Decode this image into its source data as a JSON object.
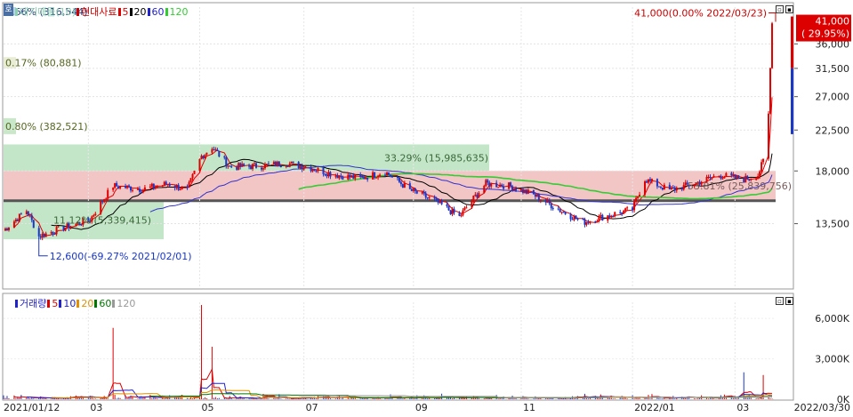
{
  "price_panel": {
    "legend": [
      {
        "text": "대기매물(10)",
        "color": "#8fd0b0"
      },
      {
        "text": "현대사료",
        "color": "#cc0000"
      },
      {
        "text": "5",
        "color": "#e00000"
      },
      {
        "text": "20",
        "color": "#000000"
      },
      {
        "text": "60",
        "color": "#2222cc"
      },
      {
        "text": "120",
        "color": "#33cc33"
      }
    ],
    "corner_badge": "호",
    "current_price": "41,000",
    "current_change": "( 29.95%)",
    "high_annotation": "41,000(0.00% 2022/03/23)",
    "low_annotation": "12,600(-69.27% 2021/02/01)",
    "y_ticks": [
      "36,000",
      "31,500",
      "27,000",
      "22,500",
      "18,000",
      "13,500"
    ],
    "y_tick_values": [
      36000,
      31500,
      27000,
      22500,
      18000,
      13500
    ],
    "y_range": [
      9500,
      44000
    ]
  },
  "volume_profile": [
    {
      "label": "0.66% (316,544)",
      "low": 42000,
      "high": 44000,
      "pct": 0.66,
      "color": "#b9d3ea"
    },
    {
      "label": "0.17% (80,881)",
      "low": 31500,
      "high": 33500,
      "pct": 0.17,
      "color": "#e9edd6"
    },
    {
      "label": "0.80% (382,521)",
      "low": 22000,
      "high": 24000,
      "pct": 0.8,
      "color": "#c9e8c9"
    },
    {
      "label": "33.29% (15,985,635)",
      "low": 18000,
      "high": 20800,
      "pct": 33.29,
      "color": "#c4e6c8"
    },
    {
      "label": "53.81% (25,839,756)",
      "low": 15300,
      "high": 18000,
      "pct": 53.81,
      "color": "#f3c6c6"
    },
    {
      "label": "11.12% (5,339,415)",
      "low": 12400,
      "high": 15300,
      "pct": 11.12,
      "color": "#c4e6c8"
    }
  ],
  "volume_panel": {
    "legend": [
      {
        "text": "거래량",
        "color": "#2222cc"
      },
      {
        "text": "5",
        "color": "#e00000"
      },
      {
        "text": "10",
        "color": "#2222cc"
      },
      {
        "text": "20",
        "color": "#e09000"
      },
      {
        "text": "60",
        "color": "#007700"
      },
      {
        "text": "120",
        "color": "#999999"
      }
    ],
    "y_ticks": [
      "6,000K",
      "3,000K",
      "0K"
    ],
    "y_tick_values": [
      6000000,
      3000000,
      0
    ],
    "y_range": [
      0,
      7200000
    ]
  },
  "x_axis": {
    "labels": [
      "2021/01/12",
      "03",
      "05",
      "07",
      "09",
      "11",
      "2022/01",
      "03",
      "2022/03/30"
    ]
  },
  "chart_data": {
    "type": "candlestick",
    "x_range": [
      "2021/01/12",
      "2022/03/30"
    ],
    "price": [
      {
        "date": "2021/01/12",
        "close": 13000
      },
      {
        "date": "2021/01/25",
        "close": 14500
      },
      {
        "date": "2021/02/01",
        "close": 12600
      },
      {
        "date": "2021/02/15",
        "close": 13200
      },
      {
        "date": "2021/03/02",
        "close": 13800
      },
      {
        "date": "2021/03/15",
        "close": 16600
      },
      {
        "date": "2021/04/01",
        "close": 16300
      },
      {
        "date": "2021/04/15",
        "close": 16800
      },
      {
        "date": "2021/04/26",
        "close": 16200
      },
      {
        "date": "2021/05/04",
        "close": 19500
      },
      {
        "date": "2021/05/10",
        "close": 20500
      },
      {
        "date": "2021/05/20",
        "close": 18400
      },
      {
        "date": "2021/06/07",
        "close": 18500
      },
      {
        "date": "2021/06/21",
        "close": 18800
      },
      {
        "date": "2021/07/05",
        "close": 18300
      },
      {
        "date": "2021/07/19",
        "close": 17600
      },
      {
        "date": "2021/08/02",
        "close": 17300
      },
      {
        "date": "2021/08/16",
        "close": 17900
      },
      {
        "date": "2021/08/30",
        "close": 16200
      },
      {
        "date": "2021/09/13",
        "close": 15300
      },
      {
        "date": "2021/09/27",
        "close": 14000
      },
      {
        "date": "2021/10/12",
        "close": 16800
      },
      {
        "date": "2021/10/25",
        "close": 16600
      },
      {
        "date": "2021/11/08",
        "close": 15800
      },
      {
        "date": "2021/11/22",
        "close": 14600
      },
      {
        "date": "2021/12/06",
        "close": 13600
      },
      {
        "date": "2021/12/20",
        "close": 14100
      },
      {
        "date": "2022/01/03",
        "close": 14600
      },
      {
        "date": "2022/01/10",
        "close": 17200
      },
      {
        "date": "2022/01/24",
        "close": 16200
      },
      {
        "date": "2022/02/07",
        "close": 16800
      },
      {
        "date": "2022/02/21",
        "close": 17600
      },
      {
        "date": "2022/03/07",
        "close": 17200
      },
      {
        "date": "2022/03/15",
        "close": 17600
      },
      {
        "date": "2022/03/18",
        "close": 19000
      },
      {
        "date": "2022/03/21",
        "close": 24500
      },
      {
        "date": "2022/03/22",
        "close": 31500
      },
      {
        "date": "2022/03/23",
        "close": 41000
      }
    ],
    "volume_spikes": [
      {
        "date": "2021/03/15",
        "volume": 5300000
      },
      {
        "date": "2021/05/04",
        "volume": 7000000
      },
      {
        "date": "2021/05/10",
        "volume": 3900000
      },
      {
        "date": "2022/03/07",
        "volume": 2000000
      },
      {
        "date": "2022/03/18",
        "volume": 1800000
      }
    ]
  }
}
